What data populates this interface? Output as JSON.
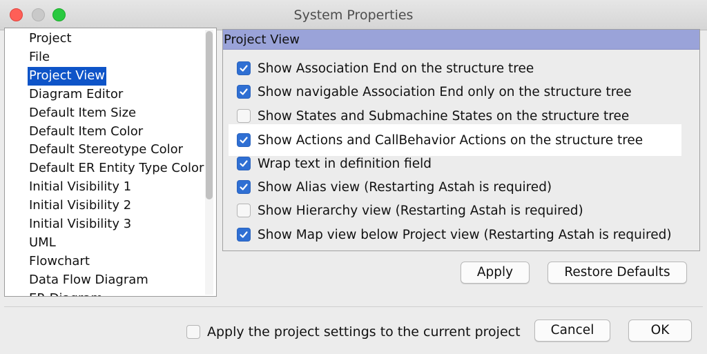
{
  "window": {
    "title": "System Properties"
  },
  "nav": {
    "items": [
      {
        "label": "Project",
        "selected": false
      },
      {
        "label": "File",
        "selected": false
      },
      {
        "label": "Project View",
        "selected": true
      },
      {
        "label": "Diagram Editor",
        "selected": false
      },
      {
        "label": "Default Item Size",
        "selected": false
      },
      {
        "label": "Default Item Color",
        "selected": false
      },
      {
        "label": "Default Stereotype Color",
        "selected": false
      },
      {
        "label": "Default ER Entity Type Color",
        "selected": false
      },
      {
        "label": "Initial Visibility 1",
        "selected": false
      },
      {
        "label": "Initial Visibility 2",
        "selected": false
      },
      {
        "label": "Initial Visibility 3",
        "selected": false
      },
      {
        "label": "UML",
        "selected": false
      },
      {
        "label": "Flowchart",
        "selected": false
      },
      {
        "label": "Data Flow Diagram",
        "selected": false
      },
      {
        "label": "ER Diagram",
        "selected": false
      }
    ]
  },
  "panel": {
    "header": "Project View",
    "options": [
      {
        "label": "Show Association End on the structure tree",
        "checked": true
      },
      {
        "label": "Show navigable Association End only on the structure tree",
        "checked": true
      },
      {
        "label": "Show States and Submachine States on the structure tree",
        "checked": false
      },
      {
        "label": "Show Actions and CallBehavior Actions on the structure tree",
        "checked": true
      },
      {
        "label": "Wrap text in definition field",
        "checked": true
      },
      {
        "label": "Show Alias view (Restarting Astah is required)",
        "checked": true
      },
      {
        "label": "Show Hierarchy view (Restarting Astah is required)",
        "checked": false
      },
      {
        "label": "Show Map view below Project view (Restarting Astah is required)",
        "checked": true
      }
    ],
    "apply_label": "Apply",
    "restore_label": "Restore Defaults"
  },
  "footer": {
    "apply_project_label": "Apply the project settings to the current project",
    "apply_project_checked": false,
    "cancel_label": "Cancel",
    "ok_label": "OK"
  },
  "colors": {
    "selection": "#0e54c8",
    "header_bg": "#9aa3d9",
    "checkbox_on": "#2f6fd3"
  }
}
